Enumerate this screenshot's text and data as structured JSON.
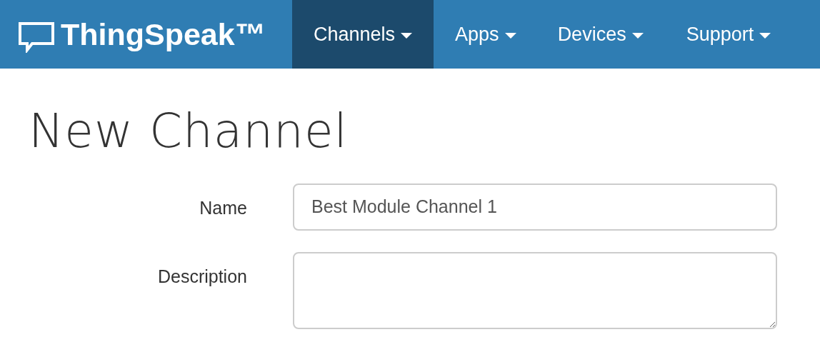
{
  "logo": {
    "text": "ThingSpeak™"
  },
  "nav": [
    {
      "label": "Channels",
      "selected": true,
      "dropdown": true
    },
    {
      "label": "Apps",
      "selected": false,
      "dropdown": true
    },
    {
      "label": "Devices",
      "selected": false,
      "dropdown": true
    },
    {
      "label": "Support",
      "selected": false,
      "dropdown": true
    }
  ],
  "page_title": "New Channel",
  "form": [
    {
      "label": "Name",
      "kind": "text",
      "value": "Best Module Channel 1"
    },
    {
      "label": "Description",
      "kind": "textarea"
    }
  ]
}
